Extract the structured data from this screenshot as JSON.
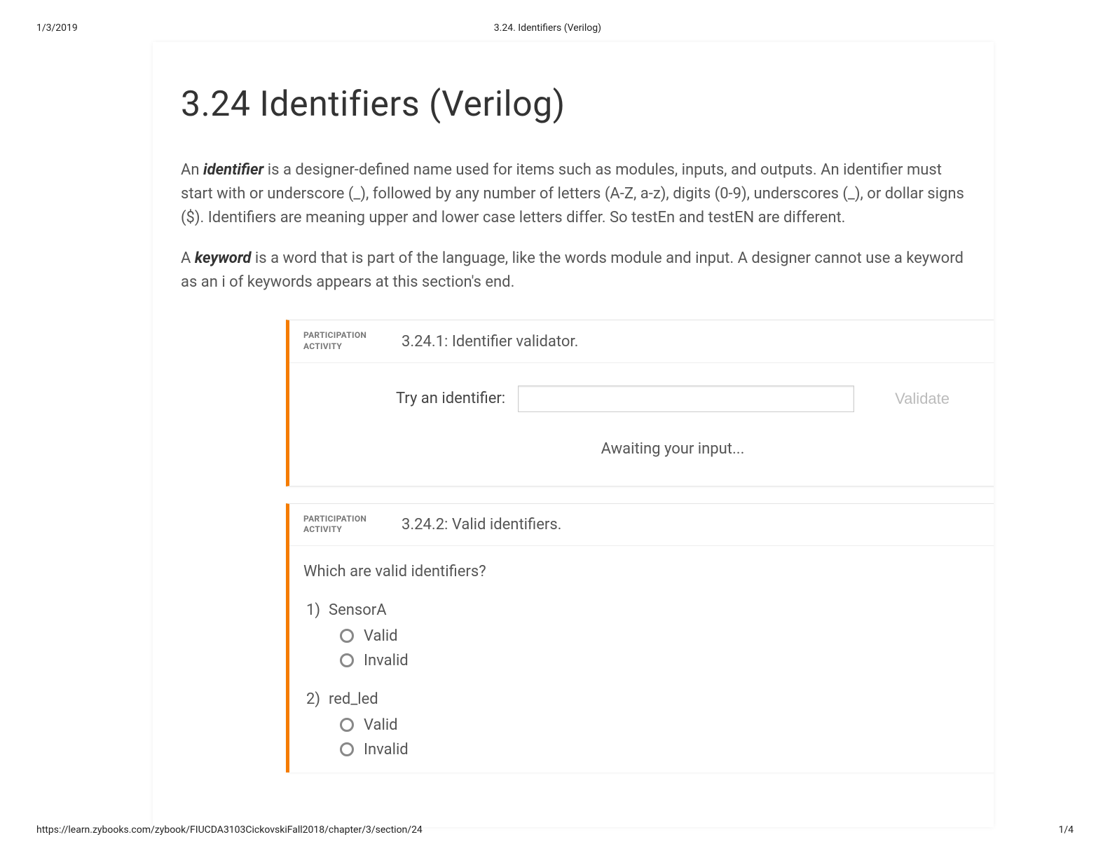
{
  "print": {
    "date": "1/3/2019",
    "header_title": "3.24. Identifiers (Verilog)",
    "footer_url": "https://learn.zybooks.com/zybook/FIUCDA3103CickovskiFall2018/chapter/3/section/24",
    "page_num": "1/4"
  },
  "page": {
    "title": "3.24 Identifiers (Verilog)",
    "para1_pre": "An ",
    "para1_bold": "identifier",
    "para1_post": " is a designer-defined name used for items such as modules, inputs, and outputs. An identifier must start with or underscore (_), followed by any number of letters (A-Z, a-z), digits (0-9), underscores (_), or dollar signs ($). Identifiers are meaning upper and lower case letters differ. So testEn and testEN are different.",
    "para2_pre": "A ",
    "para2_bold": "keyword",
    "para2_post": " is a word that is part of the language, like the words module and input. A designer cannot use a keyword as an i of keywords appears at this section's end."
  },
  "activity1": {
    "badge_line1": "PARTICIPATION",
    "badge_line2": "ACTIVITY",
    "title": "3.24.1: Identifier validator.",
    "try_label": "Try an identifier:",
    "validate_label": "Validate",
    "await_msg": "Awaiting your input..."
  },
  "activity2": {
    "badge_line1": "PARTICIPATION",
    "badge_line2": "ACTIVITY",
    "title": "3.24.2: Valid identifiers.",
    "prompt": "Which are valid identifiers?",
    "questions": [
      {
        "num": "1)",
        "label": "SensorA",
        "options": [
          "Valid",
          "Invalid"
        ]
      },
      {
        "num": "2)",
        "label": "red_led",
        "options": [
          "Valid",
          "Invalid"
        ]
      }
    ]
  }
}
